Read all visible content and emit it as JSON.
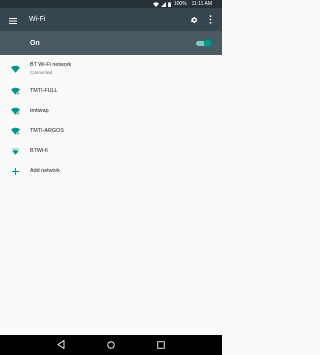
{
  "status_bar": {
    "battery": "100%",
    "time": "11:11 AM"
  },
  "app_bar": {
    "title": "Wi-Fi",
    "icons": [
      "menu-icon",
      "gear-icon",
      "more-vert-icon"
    ]
  },
  "master_switch": {
    "label": "On",
    "state": "on"
  },
  "networks": [
    {
      "name": "BT Wi-Fi network",
      "status": "Connected",
      "icon": "wifi-open-icon"
    },
    {
      "name": "TMTI-FULL",
      "icon": "wifi-locked-icon"
    },
    {
      "name": "tmtiwap",
      "icon": "wifi-locked-icon"
    },
    {
      "name": "TMTI-ARGOS",
      "icon": "wifi-locked-icon"
    },
    {
      "name": "BTWi-fi",
      "icon": "wifi-weak-icon"
    }
  ],
  "add_network": {
    "label": "Add network",
    "icon": "plus-icon"
  },
  "colors": {
    "status_bar": "#263238",
    "app_bar": "#37474f",
    "switch_bar": "#4a5a62",
    "accent": "#009688"
  },
  "nav_bar": {
    "icons": [
      "back-icon",
      "home-icon",
      "recents-icon"
    ]
  }
}
